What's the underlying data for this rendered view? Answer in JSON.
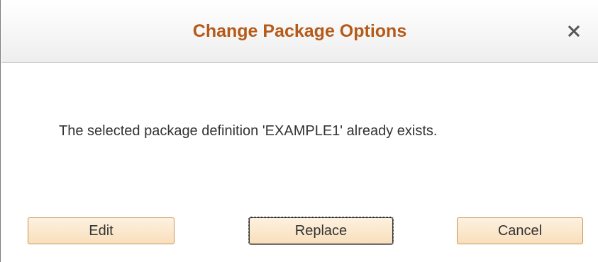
{
  "dialog": {
    "title": "Change Package Options",
    "close_icon": "close-icon",
    "message": "The selected package definition 'EXAMPLE1' already exists.",
    "buttons": {
      "edit_label": "Edit",
      "replace_label": "Replace",
      "cancel_label": "Cancel"
    }
  },
  "colors": {
    "title": "#b55a19",
    "button_fill": "#f9dfbc",
    "button_border": "#c9935a",
    "text": "#333333"
  }
}
